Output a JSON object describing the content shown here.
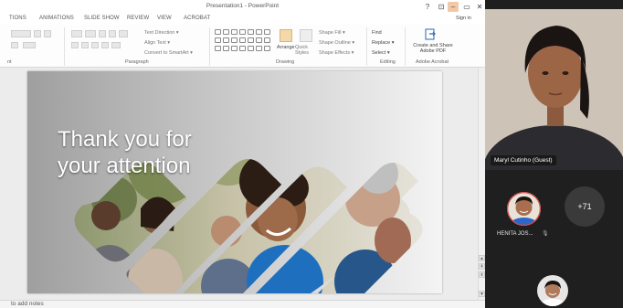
{
  "powerpoint": {
    "window_title": "Presentation1 - PowerPoint",
    "window_controls": {
      "help": "?",
      "ribbon_display": "⊡",
      "minimize": "–",
      "maximize": "▭",
      "close": "✕"
    },
    "tabs": [
      "TIONS",
      "ANIMATIONS",
      "SLIDE SHOW",
      "REVIEW",
      "VIEW",
      "ACROBAT"
    ],
    "sign_in": "Sign in",
    "ribbon": {
      "font_group_label": "nt",
      "paragraph": {
        "label": "Paragraph",
        "text_direction": "Text Direction ▾",
        "align_text": "Align Text ▾",
        "convert_smartart": "Convert to SmartArt ▾"
      },
      "drawing": {
        "label": "Drawing",
        "arrange": "Arrange",
        "quick_styles": "Quick Styles",
        "shape_fill": "Shape Fill ▾",
        "shape_outline": "Shape Outline ▾",
        "shape_effects": "Shape Effects ▾"
      },
      "editing": {
        "label": "Editing",
        "find": "Find",
        "replace": "Replace ▾",
        "select": "Select ▾"
      },
      "acrobat": {
        "label": "Adobe Acrobat",
        "create_share": "Create and Share Adobe PDF"
      }
    },
    "slide": {
      "title_line1": "Thank you for",
      "title_line2": "your attention"
    },
    "notes_placeholder": "to add notes"
  },
  "teams": {
    "presenter_name": "Maryl Cutinho (Guest)",
    "participant_name": "HENITA JOS...",
    "more_count": "+71"
  }
}
